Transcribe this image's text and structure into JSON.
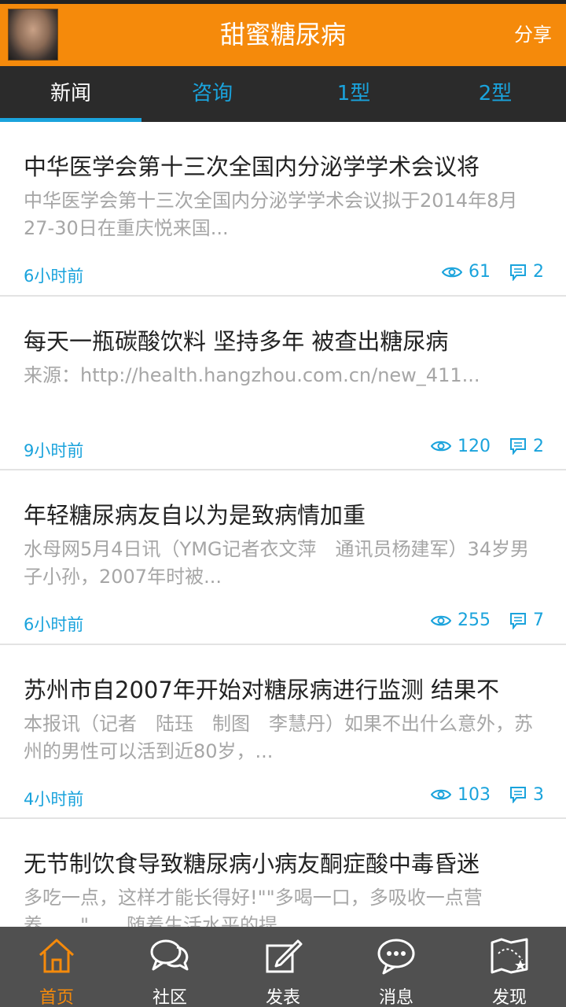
{
  "app": {
    "title": "甜蜜糖尿病",
    "share_label": "分享"
  },
  "tabs": [
    {
      "label": "新闻",
      "active": true
    },
    {
      "label": "咨询",
      "active": false
    },
    {
      "label": "1型",
      "active": false
    },
    {
      "label": "2型",
      "active": false
    }
  ],
  "feed": [
    {
      "title": "中华医学会第十三次全国内分泌学学术会议将",
      "summary": "中华医学会第十三次全国内分泌学学术会议拟于2014年8月27-30日在重庆悦来国...",
      "time": "6小时前",
      "views": "61",
      "comments": "2"
    },
    {
      "title": "每天一瓶碳酸饮料 坚持多年 被查出糖尿病",
      "summary": "来源：http://health.hangzhou.com.cn/new_411...",
      "time": "9小时前",
      "views": "120",
      "comments": "2"
    },
    {
      "title": "年轻糖尿病友自以为是致病情加重",
      "summary": "水母网5月4日讯（YMG记者衣文萍　通讯员杨建军）34岁男子小孙，2007年时被...",
      "time": "6小时前",
      "views": "255",
      "comments": "7"
    },
    {
      "title": "苏州市自2007年开始对糖尿病进行监测 结果不",
      "summary": "本报讯（记者　陆珏　制图　李慧丹）如果不出什么意外，苏州的男性可以活到近80岁，...",
      "time": "4小时前",
      "views": "103",
      "comments": "3"
    },
    {
      "title": "无节制饮食导致糖尿病小病友酮症酸中毒昏迷",
      "summary": "多吃一点，这样才能长得好!\"\"多喝一口，多吸收一点营养……\"……随着生活水平的提",
      "time": "",
      "views": "",
      "comments": ""
    }
  ],
  "bottom_nav": [
    {
      "label": "首页",
      "icon": "home-icon",
      "active": true
    },
    {
      "label": "社区",
      "icon": "community-icon",
      "active": false
    },
    {
      "label": "发表",
      "icon": "compose-icon",
      "active": false
    },
    {
      "label": "消息",
      "icon": "message-icon",
      "active": false
    },
    {
      "label": "发现",
      "icon": "discover-icon",
      "active": false
    }
  ],
  "colors": {
    "accent": "#f58a0b",
    "link": "#1aa3dc",
    "tabbar": "#2b2b2b",
    "navbar": "#505050"
  }
}
